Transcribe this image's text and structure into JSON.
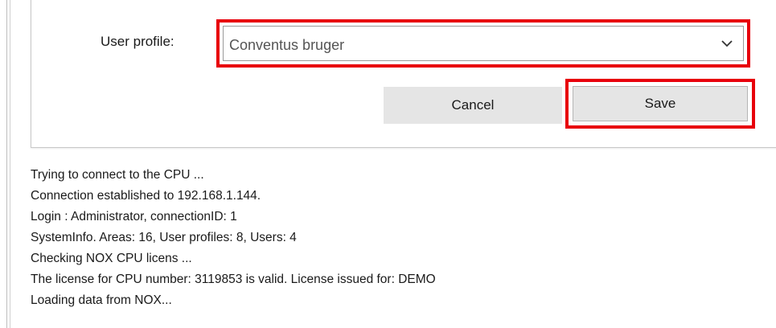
{
  "dialog": {
    "profile_label": "User profile:",
    "profile_value": "Conventus bruger",
    "cancel_label": "Cancel",
    "save_label": "Save",
    "highlight_color": "#e8000b"
  },
  "log": {
    "lines": [
      "Trying to connect to the CPU ...",
      "Connection established to 192.168.1.144.",
      "Login : Administrator, connectionID: 1",
      "SystemInfo. Areas: 16, User profiles: 8, Users: 4",
      "Checking NOX CPU licens ...",
      "The license for CPU number: 3119853 is valid. License issued for: DEMO",
      "Loading data from NOX..."
    ]
  },
  "icons": {
    "dropdown": "chevron-down-icon"
  }
}
